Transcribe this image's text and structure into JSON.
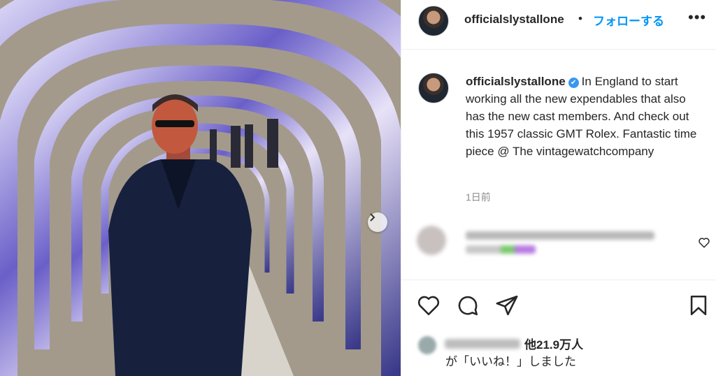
{
  "post": {
    "username": "officialslystallone",
    "follow_label": "フォローする",
    "separator": "•",
    "more_label": "•••",
    "caption": "In England to start working all the new expendables that also has the new cast members. And check out this 1957 classic GMT Rolex. Fantastic time piece @ The vintagewatchcompany",
    "verified_icon": "✔",
    "timestamp": "1日前",
    "likes_count": "他21.9万人",
    "likes_suffix": "が「いいね！」しました",
    "next_icon": "›"
  },
  "icons": {
    "like": "heart-icon",
    "comment": "comment-icon",
    "share": "paper-plane-icon",
    "save": "bookmark-icon",
    "next": "chevron-right-icon",
    "verified": "verified-badge-icon"
  },
  "colors": {
    "accent": "#0095f6",
    "text": "#262626",
    "muted": "#8e8e8e",
    "verified": "#3897f0",
    "border": "#efefef"
  }
}
